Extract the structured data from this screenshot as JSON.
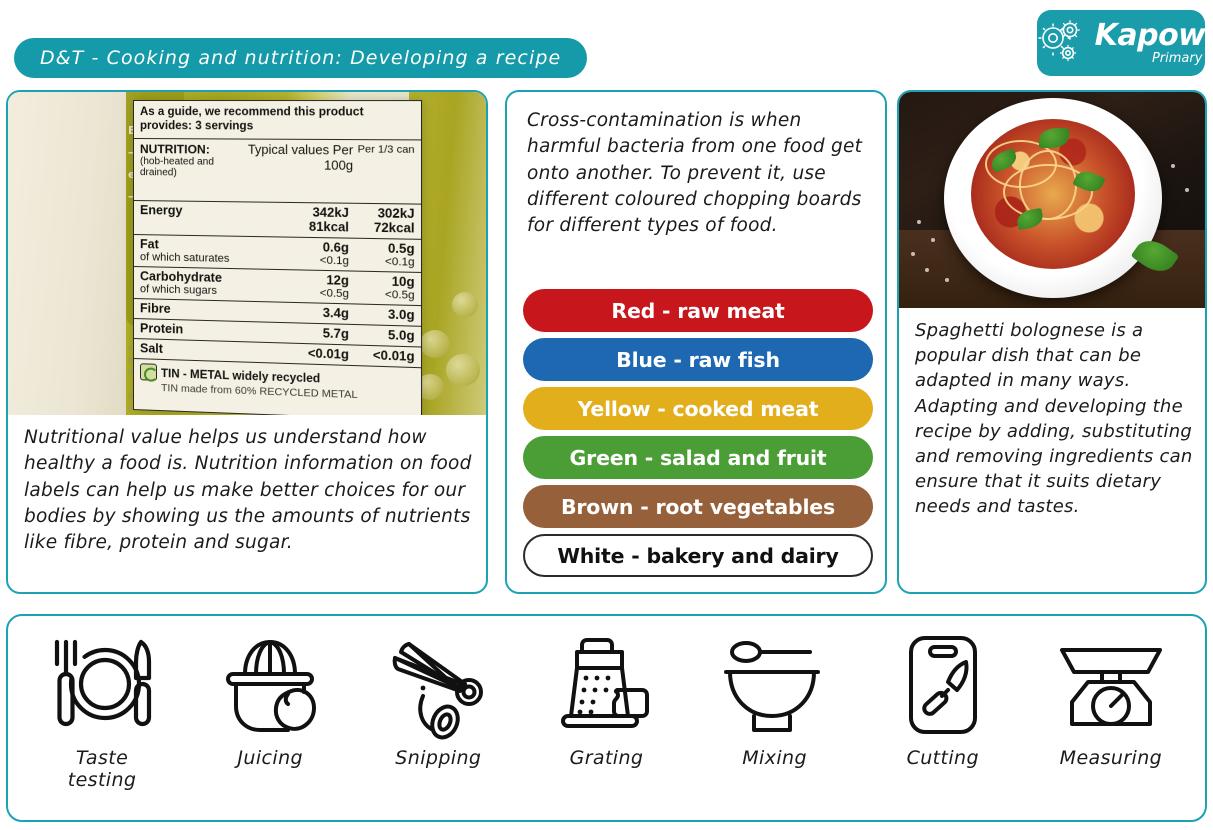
{
  "header": {
    "title": "D&T - Cooking and nutrition: Developing a recipe",
    "logo_name": "Kapow",
    "logo_sub": "Primary",
    "teal": "#149aa8"
  },
  "left_card": {
    "image_alt": "nutrition-label-on-can",
    "nutrition_label": {
      "guide": "As a guide, we recommend this product provides: 3 servings",
      "head_title": "NUTRITION:",
      "head_sub": "(hob-heated and drained)",
      "col_typical": "Typical values Per 100g",
      "col_per_can": "Per 1/3 can",
      "rows": [
        {
          "name": "Energy",
          "sub": "",
          "v1": "342kJ",
          "v1b": "81kcal",
          "v2": "302kJ",
          "v2b": "72kcal"
        },
        {
          "name": "Fat",
          "sub": "of which saturates",
          "v1": "0.6g",
          "v1b": "<0.1g",
          "v2": "0.5g",
          "v2b": "<0.1g"
        },
        {
          "name": "Carbohydrate",
          "sub": "of which sugars",
          "v1": "12g",
          "v1b": "<0.5g",
          "v2": "10g",
          "v2b": "<0.5g"
        },
        {
          "name": "Fibre",
          "sub": "",
          "v1": "3.4g",
          "v1b": "",
          "v2": "3.0g",
          "v2b": ""
        },
        {
          "name": "Protein",
          "sub": "",
          "v1": "5.7g",
          "v1b": "",
          "v2": "5.0g",
          "v2b": ""
        },
        {
          "name": "Salt",
          "sub": "",
          "v1": "<0.01g",
          "v1b": "",
          "v2": "<0.01g",
          "v2b": ""
        }
      ],
      "recycle_title": "TIN - METAL  widely recycled",
      "recycle_sub": "TIN made from 60% RECYCLED METAL"
    },
    "caption": "Nutritional value helps us understand how healthy a food is. Nutrition information on food labels can help us make better choices for our bodies by showing us the amounts of nutrients like fibre, protein and sugar."
  },
  "mid_card": {
    "intro": "Cross-contamination is when harmful bacteria from one food get onto another. To prevent it, use different coloured chopping boards for different types of food.",
    "boards": [
      {
        "label": "Red - raw meat",
        "bg": "#c8161d",
        "fg": "#ffffff"
      },
      {
        "label": "Blue - raw fish",
        "bg": "#1d68b0",
        "fg": "#ffffff"
      },
      {
        "label": "Yellow - cooked meat",
        "bg": "#e3ae1c",
        "fg": "#ffffff"
      },
      {
        "label": "Green - salad and fruit",
        "bg": "#4a9e35",
        "fg": "#ffffff"
      },
      {
        "label": "Brown - root vegetables",
        "bg": "#96613a",
        "fg": "#ffffff"
      },
      {
        "label": "White - bakery and dairy",
        "bg": "#ffffff",
        "fg": "#111111"
      }
    ]
  },
  "right_card": {
    "image_alt": "spaghetti-bolognese-photo",
    "caption": "Spaghetti bolognese is a popular dish that can be adapted in many ways. Adapting and developing the recipe by adding, substituting and removing ingredients can ensure that it suits dietary needs and tastes."
  },
  "skills": [
    {
      "icon": "plate-fork-knife-icon",
      "label": "Taste\ntesting"
    },
    {
      "icon": "citrus-juicer-icon",
      "label": "Juicing"
    },
    {
      "icon": "scissors-icon",
      "label": "Snipping"
    },
    {
      "icon": "box-grater-icon",
      "label": "Grating"
    },
    {
      "icon": "mixing-bowl-icon",
      "label": "Mixing"
    },
    {
      "icon": "chopping-board-knife-icon",
      "label": "Cutting"
    },
    {
      "icon": "kitchen-scale-icon",
      "label": "Measuring"
    }
  ]
}
